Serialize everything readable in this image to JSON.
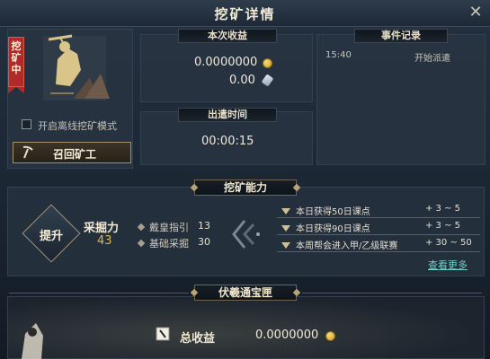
{
  "window": {
    "title": "挖矿详情",
    "close_symbol": "✕"
  },
  "mining": {
    "status_tag": "挖矿中",
    "offline_mode_label": "开启离线挖矿模式",
    "offline_mode_checked": false,
    "recall_button_label": "召回矿工"
  },
  "earnings": {
    "header": "本次收益",
    "coin_amount": "0.0000000",
    "silver_amount": "0.00"
  },
  "dispatch_time": {
    "header": "出遣时间",
    "value": "00:00:15"
  },
  "event_log": {
    "header": "事件记录",
    "entries": [
      {
        "time": "15:40",
        "text": "开始派遣"
      }
    ]
  },
  "ability": {
    "section_title": "挖矿能力",
    "boost_button_label": "提升",
    "power_label": "采掘力",
    "power_value": "43",
    "stats": [
      {
        "label": "戴皇指引",
        "value": "13"
      },
      {
        "label": "基础采掘",
        "value": "30"
      }
    ],
    "quests": [
      {
        "text": "本日获得50日课点",
        "reward": "+ 3 ~ 5"
      },
      {
        "text": "本日获得90日课点",
        "reward": "+ 3 ~ 5"
      },
      {
        "text": "本周帮会进入甲/乙级联赛",
        "reward": "+ 30 ~ 50"
      }
    ],
    "more_link": "查看更多"
  },
  "treasure": {
    "section_title": "伏羲通宝匣",
    "total_label": "总收益",
    "total_value": "0.0000000"
  },
  "colors": {
    "accent_gold": "#d9b64e",
    "status_red": "#b02a2a",
    "link_teal": "#6fd0c8"
  },
  "icons": {
    "coin": "gold-coin-icon",
    "silver": "silver-ingot-icon",
    "recall": "pickaxe-icon",
    "treasure": "scroll-icon"
  }
}
